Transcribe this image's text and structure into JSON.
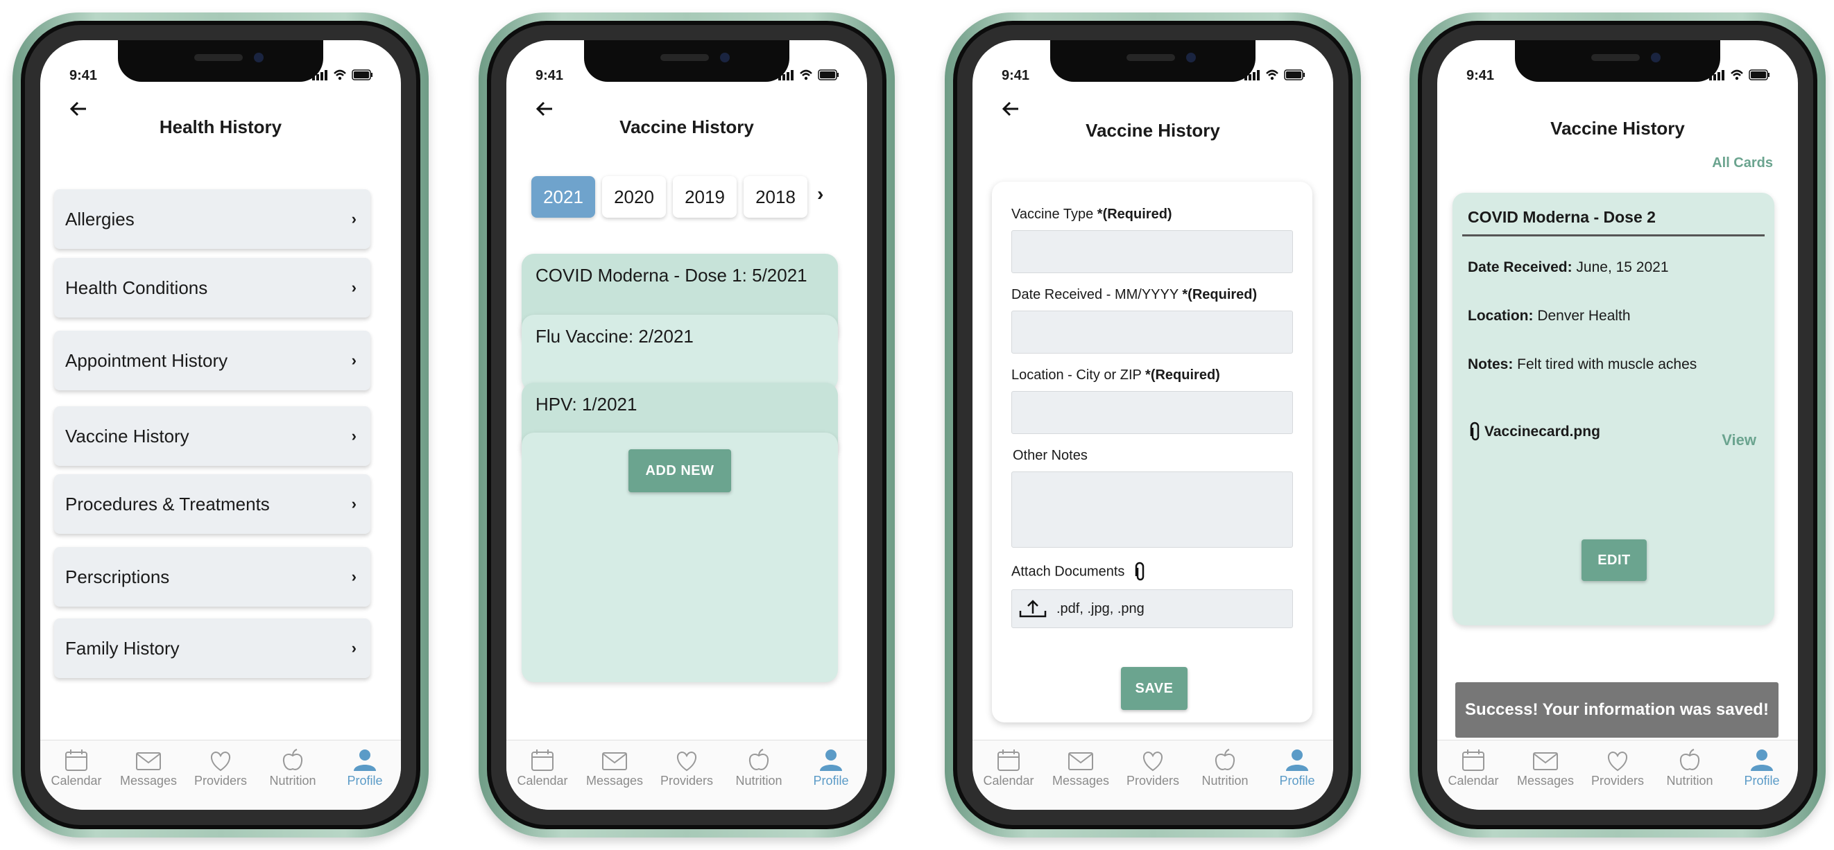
{
  "status_time": "9:41",
  "tabbar": [
    {
      "label": "Calendar",
      "icon": "calendar-icon"
    },
    {
      "label": "Messages",
      "icon": "mail-icon"
    },
    {
      "label": "Providers",
      "icon": "heart-icon"
    },
    {
      "label": "Nutrition",
      "icon": "apple-icon"
    },
    {
      "label": "Profile",
      "icon": "user-icon",
      "active": true
    }
  ],
  "screen1": {
    "title": "Health History",
    "items": [
      "Allergies",
      "Health Conditions",
      "Appointment History",
      "Vaccine History",
      "Procedures & Treatments",
      "Perscriptions",
      "Family History"
    ]
  },
  "screen2": {
    "title": "Vaccine History",
    "years": [
      "2021",
      "2020",
      "2019",
      "2018"
    ],
    "active_year": "2021",
    "cards": [
      "COVID Moderna - Dose 1: 5/2021",
      "Flu Vaccine: 2/2021",
      "HPV: 1/2021"
    ],
    "add_new": "ADD NEW"
  },
  "screen3": {
    "title": "Vaccine History",
    "fields": [
      {
        "label": "Vaccine Type ",
        "required": "*(Required)"
      },
      {
        "label": "Date Received - MM/YYYY ",
        "required": "*(Required)"
      },
      {
        "label": "Location - City or ZIP ",
        "required": "*(Required)"
      },
      {
        "label": "Other Notes",
        "required": ""
      }
    ],
    "attach_label": "Attach Documents",
    "attach_hint": ".pdf, .jpg, .png",
    "save": "SAVE"
  },
  "screen4": {
    "title": "Vaccine History",
    "all_cards": "All Cards",
    "card_title": "COVID Moderna - Dose 2",
    "date_label": "Date Received:",
    "date_value": " June, 15 2021",
    "location_label": "Location:",
    "location_value": " Denver Health",
    "notes_label": "Notes:",
    "notes_value": " Felt tired with muscle aches",
    "file_name": "Vaccinecard.png",
    "view": "View",
    "edit": "EDIT",
    "toast": "Success! Your information was saved!"
  },
  "colors": {
    "accent_green": "#6ba48f",
    "card_green": "#d7ebe4",
    "active_blue": "#6fa3cc",
    "profile_blue": "#5b9bc7"
  }
}
